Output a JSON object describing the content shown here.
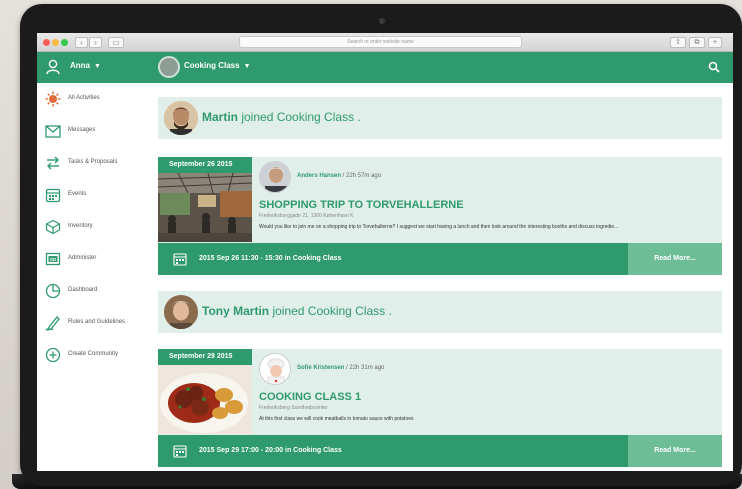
{
  "browser": {
    "address_placeholder": "Search or enter website name"
  },
  "header": {
    "user_name": "Anna",
    "community_name": "Cooking Class"
  },
  "sidebar": {
    "items": [
      {
        "label": "All Activities",
        "icon": "activity-icon"
      },
      {
        "label": "Messages",
        "icon": "envelope-icon"
      },
      {
        "label": "Tasks & Proposals",
        "icon": "swap-arrows-icon"
      },
      {
        "label": "Events",
        "icon": "calendar-icon"
      },
      {
        "label": "Inventory",
        "icon": "box-icon"
      },
      {
        "label": "Administer",
        "icon": "sd-card-icon"
      },
      {
        "label": "Dashboard",
        "icon": "pie-chart-icon"
      },
      {
        "label": "Rules and Guidelines",
        "icon": "pen-icon"
      },
      {
        "label": "Create Community",
        "icon": "plus-circle-icon"
      }
    ]
  },
  "feed": {
    "join1": {
      "name": "Martin",
      "rest": " joined Cooking Class ."
    },
    "event1": {
      "date": "September 26 2015",
      "poster": "Anders Hansen",
      "ago": " / 22h 57m ago",
      "title": "SHOPPING TRIP TO TORVEHALLERNE",
      "address": "Frederiksborggade 21, 1360 København K",
      "description": "Would you like to join me on a shopping trip to Torvehallerne? I suggest we start having a lunch and then look around the interesting booths and discuss ingredie...",
      "when": "2015 Sep 26 11:30 - 15:30 in Cooking Class",
      "read_more": "Read More..."
    },
    "join2": {
      "name": "Tony Martin",
      "rest": " joined Cooking Class ."
    },
    "event2": {
      "date": "September 29 2015",
      "poster": "Sofie Kristensen",
      "ago": " / 22h 31m ago",
      "title": "COOKING CLASS 1",
      "address": "Frederiksberg Sundhedscenter",
      "description": "At this first class we will cook meatballs in tomato sauce with potatoes",
      "when": "2015 Sep 29 17:00 - 20:00 in Cooking Class",
      "read_more": "Read More..."
    }
  },
  "colors": {
    "brand_green": "#2e9a6d",
    "light_green": "#e1efea",
    "read_more_green": "#6dbd97"
  }
}
